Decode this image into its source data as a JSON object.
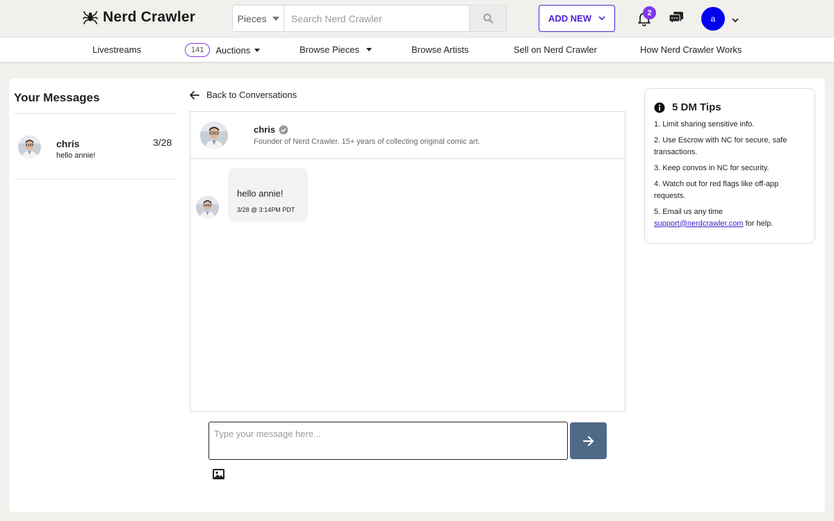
{
  "header": {
    "brand": "Nerd Crawler",
    "search": {
      "category": "Pieces",
      "placeholder": "Search Nerd Crawler"
    },
    "add_new_label": "ADD NEW",
    "notification_count": "2",
    "user_initial": "a"
  },
  "nav": {
    "livestreams": "Livestreams",
    "auctions_count": "141",
    "auctions": "Auctions",
    "browse_pieces": "Browse Pieces",
    "browse_artists": "Browse Artists",
    "sell": "Sell on Nerd Crawler",
    "how_it_works": "How Nerd Crawler Works"
  },
  "messages": {
    "title": "Your Messages",
    "conversations": [
      {
        "name": "chris",
        "date": "3/28",
        "preview": "hello annie!"
      }
    ]
  },
  "thread": {
    "back_label": "Back to Conversations",
    "contact_name": "chris",
    "contact_bio": "Founder of Nerd Crawler. 15+ years of collecting original comic art.",
    "messages": [
      {
        "text": "hello annie!",
        "timestamp": "3/28 @ 3:14PM PDT"
      }
    ],
    "composer_placeholder": "Type your message here..."
  },
  "tips": {
    "title": "5 DM Tips",
    "items": [
      "1. Limit sharing sensitive info.",
      "2. Use Escrow with NC for secure, safe transactions.",
      "3. Keep convos in NC for security.",
      "4. Watch out for red flags like off-app requests.",
      "5. Email us any time"
    ],
    "support_email": "support@nerdcrawler.com",
    "support_suffix": " for help."
  },
  "colors": {
    "accent": "#4b1fd6",
    "badge": "#7c3aed",
    "send_button": "#4e6a87",
    "avatar": "#0000ee"
  }
}
